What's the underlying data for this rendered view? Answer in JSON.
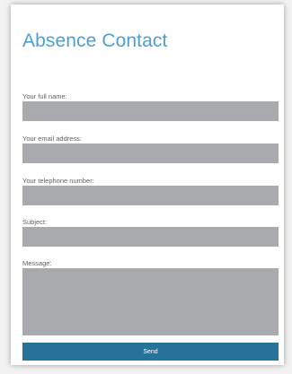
{
  "form": {
    "title": "Absence Contact",
    "fields": {
      "full_name": {
        "label": "Your full name:",
        "value": ""
      },
      "email": {
        "label": "Your email address:",
        "value": ""
      },
      "telephone": {
        "label": "Your telephone number:",
        "value": ""
      },
      "subject": {
        "label": "Subject:",
        "value": ""
      },
      "message": {
        "label": "Message:",
        "value": ""
      }
    },
    "send_label": "Send"
  },
  "colors": {
    "title": "#4a9fd6",
    "field_background": "#a9aaad",
    "button_background": "#27729a",
    "button_text": "#ffffff"
  }
}
